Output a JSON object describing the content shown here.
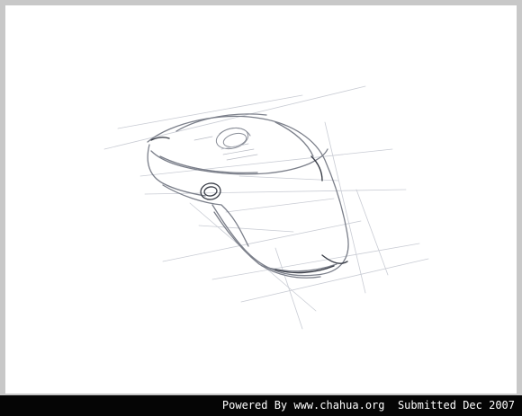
{
  "caption": {
    "text": "Powered By www.chahua.org  Submitted Dec 2007"
  }
}
